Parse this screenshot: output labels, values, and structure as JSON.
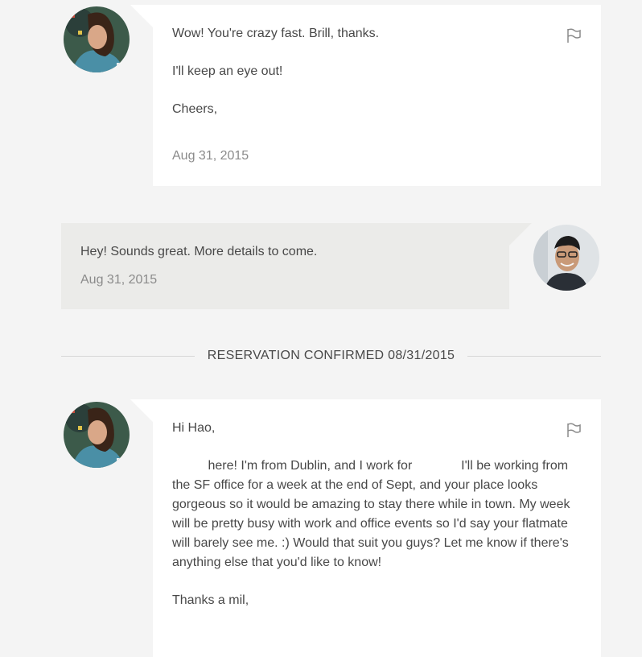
{
  "messages": [
    {
      "sender": "guest",
      "paragraphs": [
        "Wow! You're crazy fast. Brill, thanks.",
        "I'll keep an eye out!",
        "Cheers,"
      ],
      "date": "Aug 31, 2015"
    },
    {
      "sender": "host",
      "text": "Hey! Sounds great. More details to come.",
      "date": "Aug 31, 2015"
    }
  ],
  "divider": {
    "label": "RESERVATION CONFIRMED 08/31/2015"
  },
  "last_message": {
    "sender": "guest",
    "greeting": "Hi Hao,",
    "body_part1": "here! I'm from Dublin, and I work for",
    "body_part2": "I'll be working from the SF office for a week at the end of Sept, and your place looks gorgeous so it would be amazing to stay there while in town. My week will be pretty busy with work and office events so I'd say your flatmate will barely see me. :) Would that suit you guys? Let me know if there's anything else that you'd like to know!",
    "closing": "Thanks a mil,"
  },
  "icons": {
    "flag": "flag-icon"
  },
  "colors": {
    "background": "#f4f4f4",
    "guest_card": "#ffffff",
    "host_bubble": "#ebebe9",
    "date": "#8b8b8b"
  }
}
